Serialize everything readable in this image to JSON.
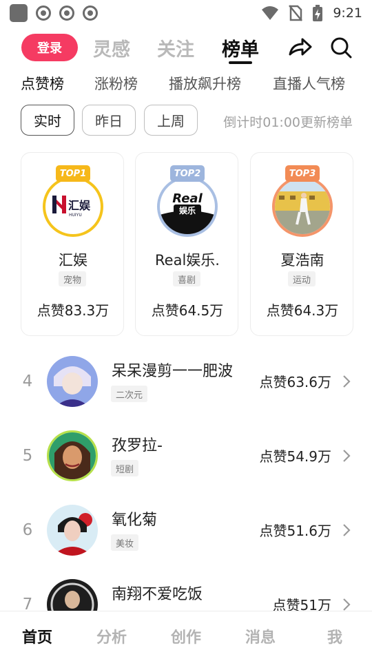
{
  "status_bar": {
    "time": "9:21",
    "left_icons": [
      "app-icon",
      "chrome-icon",
      "chrome-icon",
      "chrome-icon"
    ],
    "right_icons": [
      "wifi-icon",
      "no-sim-icon",
      "battery-charging-icon"
    ]
  },
  "top_nav": {
    "login_label": "登录",
    "tabs": [
      {
        "label": "灵感",
        "active": false
      },
      {
        "label": "关注",
        "active": false
      },
      {
        "label": "榜单",
        "active": true
      }
    ],
    "share_icon": "share-arrow-icon",
    "search_icon": "search-icon"
  },
  "sub_tabs": [
    {
      "label": "点赞榜",
      "active": true
    },
    {
      "label": "涨粉榜",
      "active": false
    },
    {
      "label": "播放飙升榜",
      "active": false
    },
    {
      "label": "直播人气榜",
      "active": false
    }
  ],
  "filters": {
    "chips": [
      {
        "label": "实时",
        "active": true
      },
      {
        "label": "昨日",
        "active": false
      },
      {
        "label": "上周",
        "active": false
      }
    ],
    "countdown": "倒计时01:00更新榜单"
  },
  "top3": [
    {
      "badge": "TOP1",
      "badge_color": "#f6b81a",
      "ring_color": "#f5c41c",
      "name": "汇娱",
      "tag": "宠物",
      "likes": "点赞83.3万",
      "logo_text": "汇娱",
      "logo_sub": "HUIYU"
    },
    {
      "badge": "TOP2",
      "badge_color": "#9db5dd",
      "ring_color": "#a9bfe3",
      "name": "Real娱乐.",
      "tag": "喜剧",
      "likes": "点赞64.5万",
      "logo_text": "Real",
      "logo_sub": "娱乐"
    },
    {
      "badge": "TOP3",
      "badge_color": "#f28b55",
      "ring_color": "#f4956a",
      "name": "夏浩南",
      "tag": "运动",
      "likes": "点赞64.3万"
    }
  ],
  "list": [
    {
      "rank": "4",
      "name": "呆呆漫剪一一肥波",
      "tag": "二次元",
      "likes": "点赞63.6万"
    },
    {
      "rank": "5",
      "name": "孜罗拉-",
      "tag": "短剧",
      "likes": "点赞54.9万"
    },
    {
      "rank": "6",
      "name": "氧化菊",
      "tag": "美妆",
      "likes": "点赞51.6万"
    },
    {
      "rank": "7",
      "name": "南翔不爱吃饭",
      "tag": "",
      "likes": "点赞51万"
    }
  ],
  "bottom_nav": [
    {
      "label": "首页",
      "active": true
    },
    {
      "label": "分析",
      "active": false
    },
    {
      "label": "创作",
      "active": false
    },
    {
      "label": "消息",
      "active": false
    },
    {
      "label": "我",
      "active": false
    }
  ]
}
